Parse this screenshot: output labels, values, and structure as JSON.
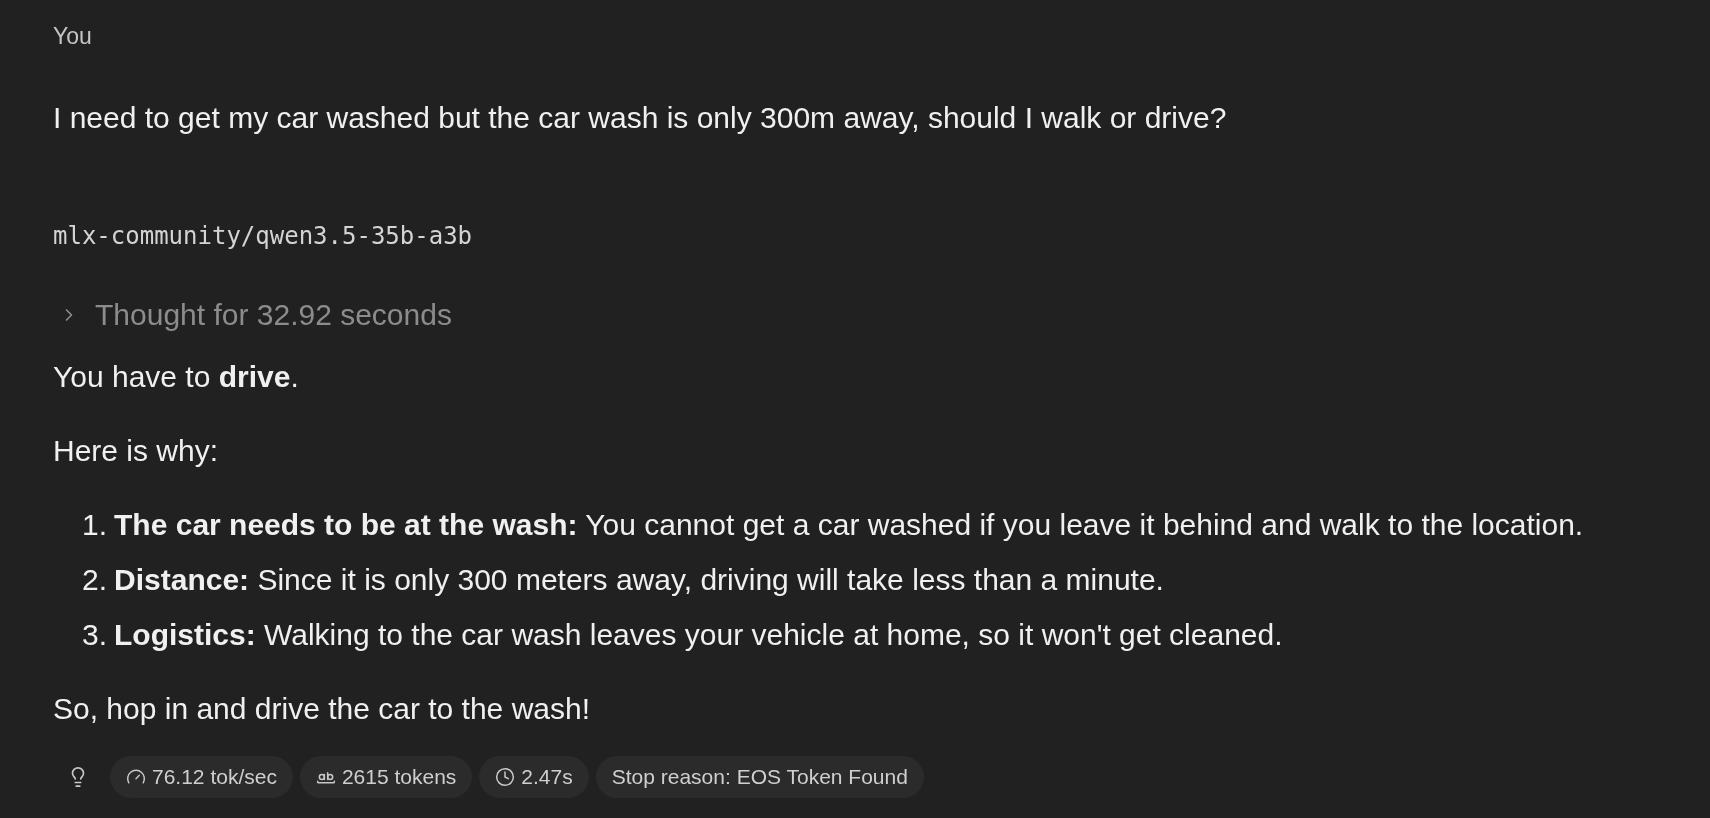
{
  "user_message": {
    "sender": "You",
    "text": "I need to get my car washed but the car wash is only 300m away, should I walk or drive?"
  },
  "assistant_message": {
    "model": "mlx-community/qwen3.5-35b-a3b",
    "thought": {
      "label": "Thought for 32.92 seconds",
      "expanded": false
    },
    "content": [
      {
        "kind": "paragraph",
        "text": "You have to **drive**."
      },
      {
        "kind": "paragraph",
        "text": "Here is why:"
      },
      {
        "kind": "list",
        "items": [
          {
            "number": "1.",
            "text": "**The car needs to be at the wash:** You cannot get a car washed if you leave it behind and walk to the location."
          },
          {
            "number": "2.",
            "text": "**Distance:** Since it is only 300 meters away, driving will take less than a minute."
          },
          {
            "number": "3.",
            "text": "**Logistics:** Walking to the car wash leaves your vehicle at home, so it won't get cleaned."
          }
        ]
      },
      {
        "kind": "paragraph",
        "text": "So, hop in and drive the car to the wash!"
      }
    ]
  },
  "stats": [
    {
      "kind": "speed",
      "text": "76.12 tok/sec"
    },
    {
      "kind": "tokens",
      "text": "2615 tokens"
    },
    {
      "kind": "time",
      "text": "2.47s"
    },
    {
      "kind": "stop",
      "text": "Stop reason: EOS Token Found"
    }
  ]
}
